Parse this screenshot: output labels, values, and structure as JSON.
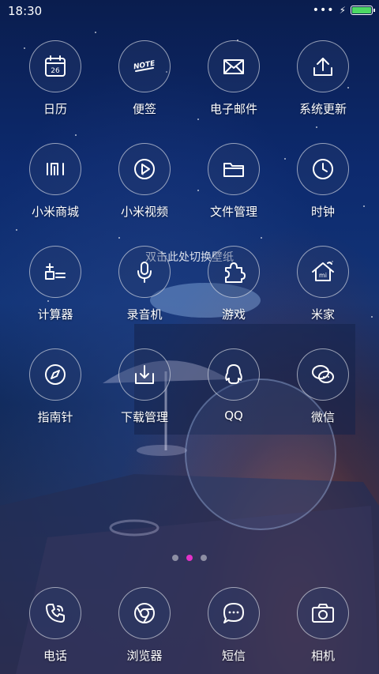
{
  "status_bar": {
    "time": "18:30",
    "battery_color": "#4cd964",
    "battery_level": 1.0
  },
  "wallpaper_hint": "双击此处切换壁纸",
  "apps": [
    {
      "label": "日历",
      "icon": "calendar-icon",
      "icon_text": "26"
    },
    {
      "label": "便签",
      "icon": "note-icon",
      "icon_text": "NOTE"
    },
    {
      "label": "电子邮件",
      "icon": "mail-icon"
    },
    {
      "label": "系统更新",
      "icon": "update-icon"
    },
    {
      "label": "小米商城",
      "icon": "mi-store-icon",
      "icon_text": "MI"
    },
    {
      "label": "小米视频",
      "icon": "video-icon"
    },
    {
      "label": "文件管理",
      "icon": "folder-icon"
    },
    {
      "label": "时钟",
      "icon": "clock-icon"
    },
    {
      "label": "计算器",
      "icon": "calculator-icon"
    },
    {
      "label": "录音机",
      "icon": "microphone-icon"
    },
    {
      "label": "游戏",
      "icon": "puzzle-icon"
    },
    {
      "label": "米家",
      "icon": "mi-home-icon",
      "icon_text": "mi"
    },
    {
      "label": "指南针",
      "icon": "compass-icon"
    },
    {
      "label": "下载管理",
      "icon": "download-icon"
    },
    {
      "label": "QQ",
      "icon": "qq-icon"
    },
    {
      "label": "微信",
      "icon": "wechat-icon"
    }
  ],
  "page_indicator": {
    "count": 3,
    "active": 1,
    "active_color": "#e333c8"
  },
  "dock": [
    {
      "label": "电话",
      "icon": "phone-icon"
    },
    {
      "label": "浏览器",
      "icon": "browser-icon"
    },
    {
      "label": "短信",
      "icon": "message-icon"
    },
    {
      "label": "相机",
      "icon": "camera-icon"
    }
  ]
}
